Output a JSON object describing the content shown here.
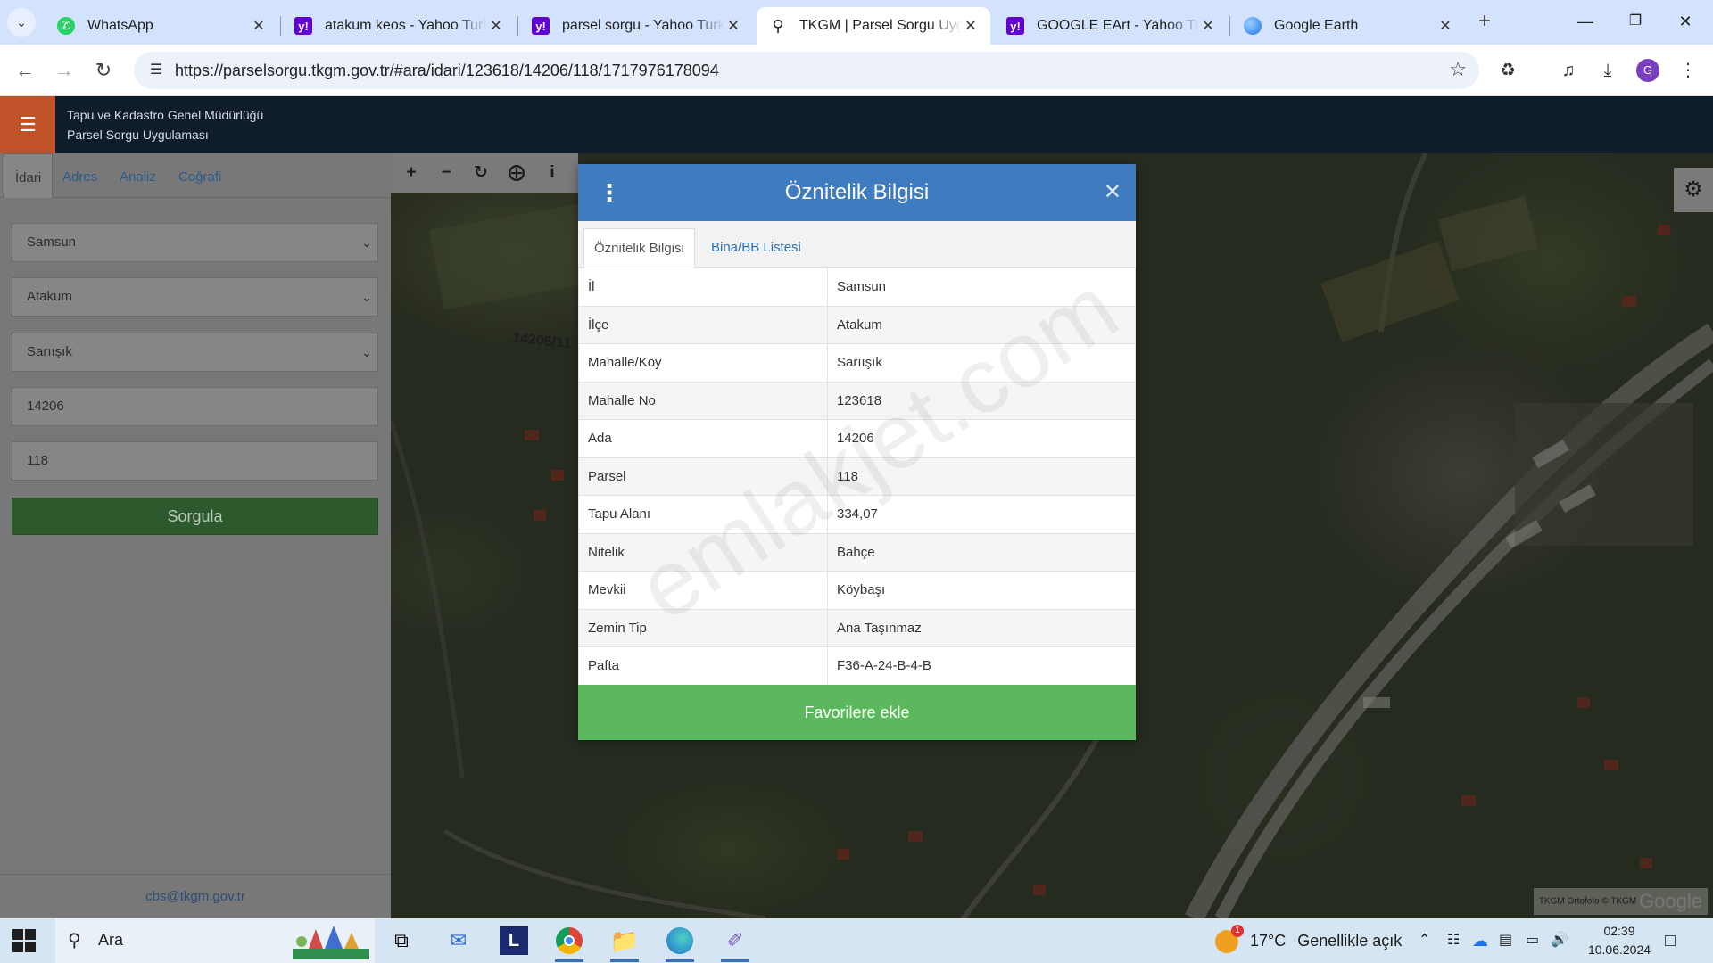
{
  "browser": {
    "tabs": [
      {
        "title": "WhatsApp",
        "icon": "whatsapp-icon"
      },
      {
        "title": "atakum keos - Yahoo Turkey",
        "icon": "yahoo-icon"
      },
      {
        "title": "parsel sorgu - Yahoo Turkey",
        "icon": "yahoo-icon"
      },
      {
        "title": "TKGM | Parsel Sorgu Uygulaması",
        "icon": "map-pin-icon",
        "active": true
      },
      {
        "title": "GOOGLE EArt - Yahoo Turkey",
        "icon": "yahoo-icon"
      },
      {
        "title": "Google Earth",
        "icon": "google-earth-icon"
      }
    ],
    "url": "https://parselsorgu.tkgm.gov.tr/#ara/idari/123618/14206/118/1717976178094",
    "profile_initial": "G"
  },
  "app": {
    "title_line1": "Tapu ve Kadastro Genel Müdürlüğü",
    "title_line2": "Parsel Sorgu Uygulaması",
    "accent": "#c0522a"
  },
  "leftpanel": {
    "tabs": [
      "İdari",
      "Adres",
      "Analiz",
      "Coğrafi"
    ],
    "il": "Samsun",
    "ilce": "Atakum",
    "mahalle": "Sarıışık",
    "ada": "14206",
    "parsel": "118",
    "query_button": "Sorgula",
    "footer_email": "cbs@tkgm.gov.tr"
  },
  "map": {
    "parcel_label": "14206/11",
    "attribution": "TKGM Ortofoto © TKGM",
    "attribution_brand": "Google"
  },
  "modal": {
    "title": "Öznitelik Bilgisi",
    "tabs": [
      "Öznitelik Bilgisi",
      "Bina/BB Listesi"
    ],
    "rows": [
      {
        "key": "İl",
        "value": "Samsun"
      },
      {
        "key": "İlçe",
        "value": "Atakum"
      },
      {
        "key": "Mahalle/Köy",
        "value": "Sarıışık"
      },
      {
        "key": "Mahalle No",
        "value": "123618"
      },
      {
        "key": "Ada",
        "value": "14206"
      },
      {
        "key": "Parsel",
        "value": "118"
      },
      {
        "key": "Tapu Alanı",
        "value": "334,07"
      },
      {
        "key": "Nitelik",
        "value": "Bahçe"
      },
      {
        "key": "Mevkii",
        "value": "Köybaşı"
      },
      {
        "key": "Zemin Tip",
        "value": "Ana Taşınmaz"
      },
      {
        "key": "Pafta",
        "value": "F36-A-24-B-4-B"
      }
    ],
    "favorite_button": "Favorilere ekle",
    "watermark": "emlakjet.com",
    "header_color": "#3e7bbf",
    "button_color": "#5cb85c"
  },
  "taskbar": {
    "search_placeholder": "Ara",
    "weather_badge": "1",
    "temperature": "17°C",
    "weather_text": "Genellikle açık",
    "time": "02:39",
    "date": "10.06.2024"
  }
}
